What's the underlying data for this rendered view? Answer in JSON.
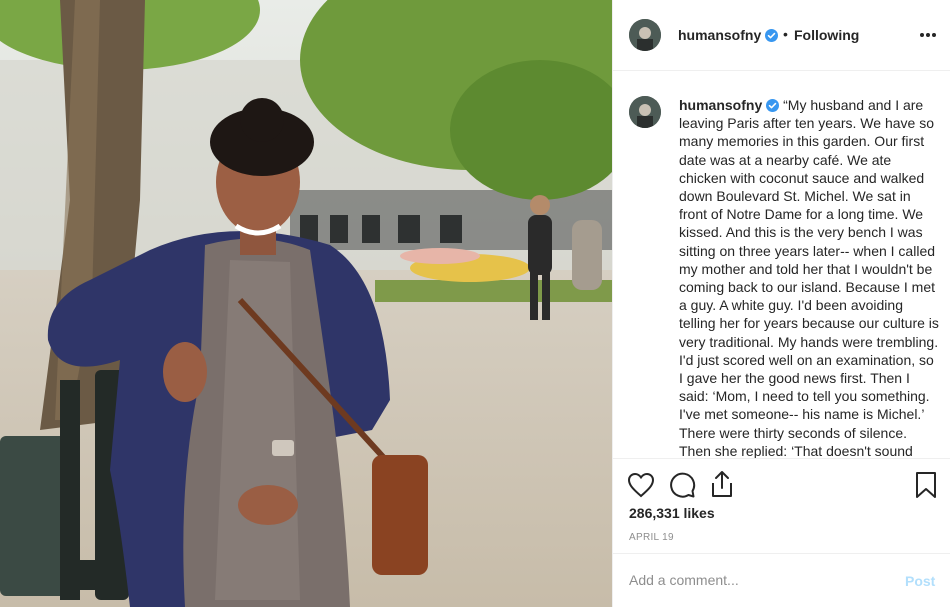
{
  "post": {
    "username": "humansofny",
    "separator": "•",
    "follow_status": "Following",
    "more_icon": "more-options-icon",
    "caption": "“My husband and I are leaving Paris after ten years. We have so many memories in this garden. Our first date was at a nearby café. We ate chicken with coconut sauce and walked down Boulevard St. Michel. We sat in front of Notre Dame for a long time. We kissed. And this is the very bench I was sitting on three years later-- when I called my mother and told her that I wouldn't be coming back to our island. Because I met a guy. A white guy. I'd been avoiding telling her for years because our culture is very traditional. My hands were trembling. I'd just scored well on an examination, so I gave her the good news first. Then I said: ‘Mom, I need to tell you something. I've met someone-- his name is Michel.’ There were thirty seconds of silence. Then she replied: ‘That doesn't sound",
    "likes": "286,331 likes",
    "date": "APRIL 19"
  },
  "comment": {
    "placeholder": "Add a comment...",
    "post_label": "Post"
  },
  "icons": [
    "heart-icon",
    "comment-icon",
    "share-icon",
    "bookmark-icon",
    "verified-badge-icon"
  ],
  "colors": {
    "text": "#262626",
    "muted": "#8e8e8e",
    "verified": "#3897f0",
    "post_disabled": "#b2dffc",
    "divider": "#efefef"
  }
}
